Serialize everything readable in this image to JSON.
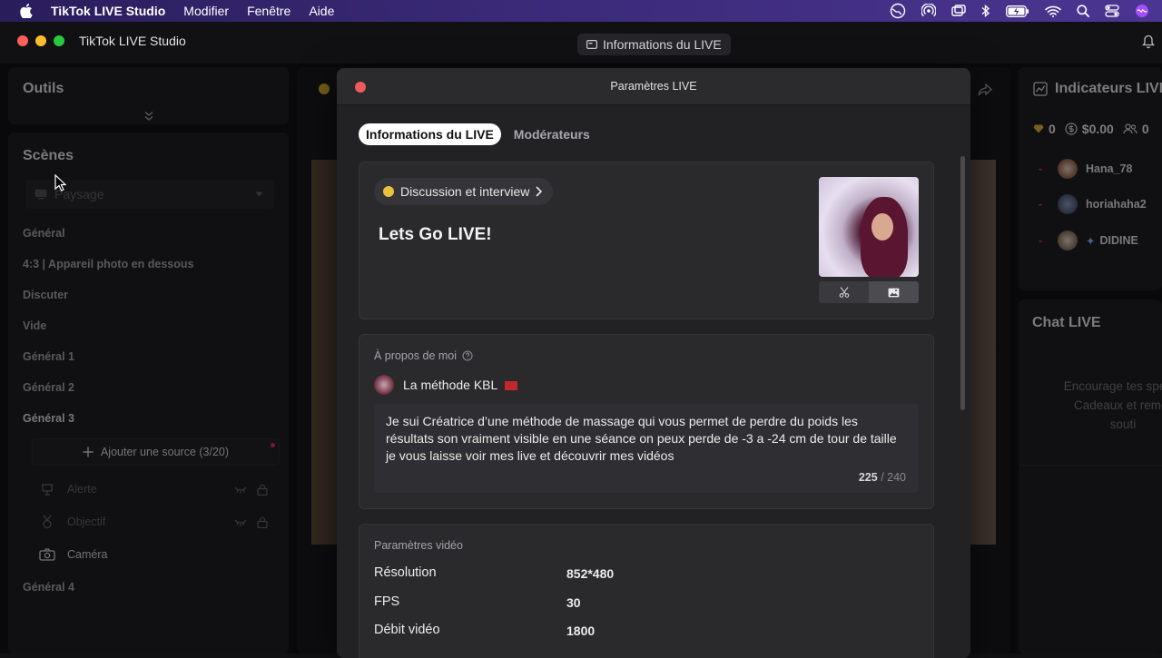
{
  "menubar": {
    "app": "TikTok LIVE Studio",
    "items": [
      "Modifier",
      "Fenêtre",
      "Aide"
    ]
  },
  "window": {
    "title": "TikTok LIVE Studio",
    "center_pill": "Informations du LIVE"
  },
  "left": {
    "tools_title": "Outils",
    "scenes_title": "Scènes",
    "scene_select": "Paysage",
    "scenes": [
      "Général",
      "4:3 | Appareil photo en dessous",
      "Discuter",
      "Vide",
      "Général 1",
      "Général 2",
      "Général 3"
    ],
    "add_source": "Ajouter une source (3/20)",
    "sources": [
      "Alerte",
      "Objectif",
      "Caméra"
    ],
    "scene_after": "Général 4"
  },
  "right": {
    "indicators_title": "Indicateurs LIVE",
    "stats": {
      "diamonds": "0",
      "money": "$0.00",
      "viewers": "0"
    },
    "viewers": [
      "Hana_78",
      "horiahaha2",
      "DIDINE"
    ],
    "chat_title": "Chat LIVE",
    "chat_msg_1": "Encourage tes specta",
    "chat_msg_2": "Cadeaux et remer",
    "chat_msg_3": "souti"
  },
  "modal": {
    "title": "Paramètres LIVE",
    "tabs": [
      "Informations du LIVE",
      "Modérateurs"
    ],
    "category": "Discussion et interview",
    "live_title": "Lets Go LIVE!",
    "about_label": "À propos de moi",
    "profile_name": "La méthode KBL ",
    "bio": "Je sui Créatrice d’une méthode de massage qui vous permet de perdre du poids les résultats son vraiment visible en une séance on peux perde de -3 a -24 cm de tour de taille je vous laisse voir mes live et découvrir mes vidéos",
    "bio_count": "225",
    "bio_max": "/ 240",
    "video_params_title": "Paramètres vidéo",
    "video_params": [
      {
        "label": "Résolution",
        "value": "852*480"
      },
      {
        "label": "FPS",
        "value": "30"
      },
      {
        "label": "Débit vidéo",
        "value": "1800"
      }
    ]
  },
  "colors": {
    "accent_red": "#e0245e",
    "close_red": "#f25a5a",
    "gold": "#e8c23a"
  }
}
